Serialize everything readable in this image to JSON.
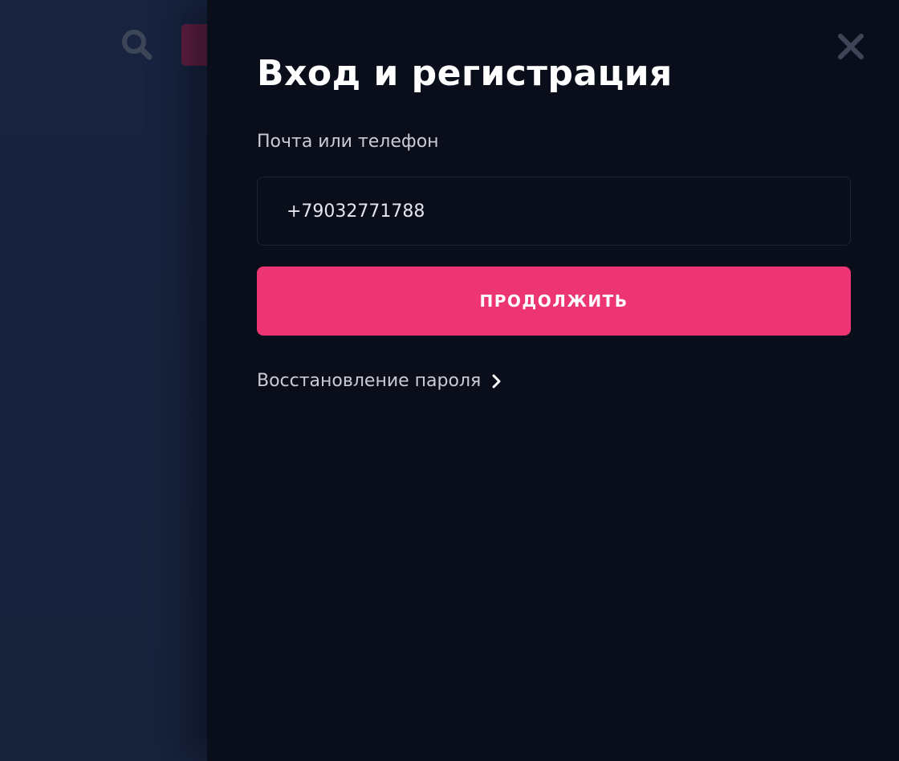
{
  "background": {
    "icons": {
      "search": "search-icon"
    },
    "colors": {
      "page_bg": "#172239",
      "accent_dimmed": "#6a2044"
    }
  },
  "drawer": {
    "title": "Вход и регистрация",
    "close_icon": "close-icon",
    "field": {
      "label": "Почта или телефон",
      "value": "+79032771788"
    },
    "continue_label": "ПРОДОЛЖИТЬ",
    "recovery": {
      "label": "Восстановление пароля",
      "icon": "chevron-right-icon"
    },
    "colors": {
      "panel_bg": "#0a0e1b",
      "accent": "#ec3572",
      "text_primary": "#ffffff",
      "text_secondary": "#c9ccd6"
    }
  }
}
